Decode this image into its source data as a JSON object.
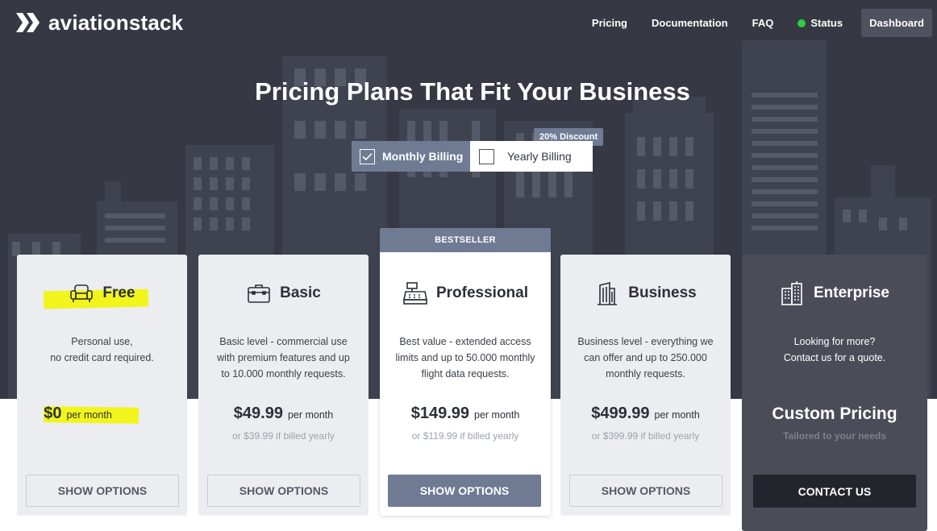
{
  "brand": {
    "name": "aviationstack"
  },
  "nav": {
    "items": [
      "Pricing",
      "Documentation",
      "FAQ"
    ],
    "status": "Status",
    "dashboard": "Dashboard"
  },
  "hero": {
    "title": "Pricing Plans That Fit Your Business"
  },
  "billing": {
    "monthly": "Monthly Billing",
    "yearly": "Yearly Billing",
    "discount": "20% Discount",
    "selected": "monthly"
  },
  "plans": [
    {
      "name": "Free",
      "icon": "armchair-icon",
      "desc1": "Personal use,",
      "desc2": "no credit card required.",
      "desc3": "",
      "price": "$0",
      "per": "per month",
      "yearly": "",
      "button": "SHOW OPTIONS"
    },
    {
      "name": "Basic",
      "icon": "briefcase-icon",
      "desc1": "Basic level - commercial use",
      "desc2": "with premium features and up",
      "desc3": "to 10.000 monthly requests.",
      "price": "$49.99",
      "per": "per month",
      "yearly": "or $39.99 if billed yearly",
      "button": "SHOW OPTIONS"
    },
    {
      "name": "Professional",
      "icon": "cash-register-icon",
      "badge": "BESTSELLER",
      "desc1": "Best value - extended access",
      "desc2": "limits and up to 50.000 monthly",
      "desc3": "flight data requests.",
      "price": "$149.99",
      "per": "per month",
      "yearly": "or $119.99 if billed yearly",
      "button": "SHOW OPTIONS"
    },
    {
      "name": "Business",
      "icon": "office-building-icon",
      "desc1": "Business level - everything we",
      "desc2": "can offer and up to 250.000",
      "desc3": "monthly requests.",
      "price": "$499.99",
      "per": "per month",
      "yearly": "or $399.99 if billed yearly",
      "button": "SHOW OPTIONS"
    },
    {
      "name": "Enterprise",
      "icon": "city-buildings-icon",
      "desc1": "Looking for more?",
      "desc2": "Contact us for a quote.",
      "desc3": "",
      "price": "Custom Pricing",
      "yearly": "Tailored to your needs",
      "button": "CONTACT US"
    }
  ],
  "colors": {
    "hero_bg": "#363944",
    "accent": "#6e7b93",
    "highlight": "#f1f51b",
    "status_green": "#2ecc40"
  }
}
